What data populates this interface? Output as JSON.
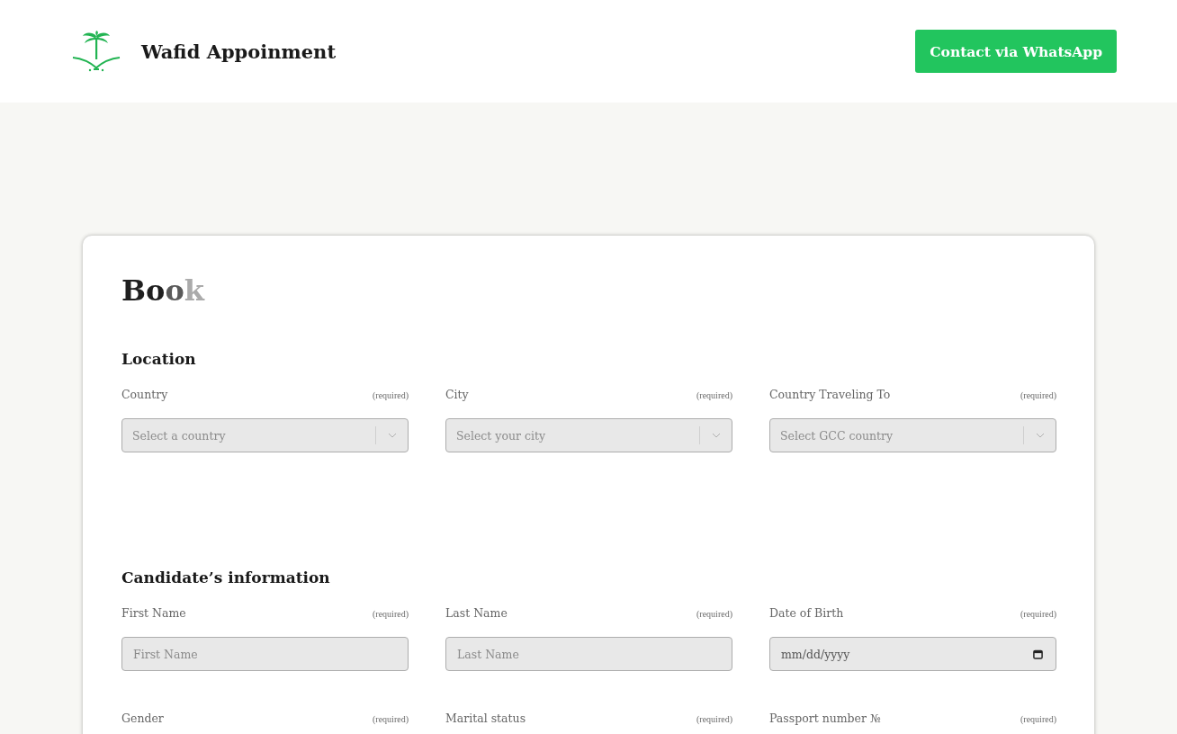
{
  "header": {
    "brand": "Wafid Appoinment",
    "contact_button": "Contact via WhatsApp"
  },
  "form": {
    "title": [
      {
        "text": "Bo",
        "color": "#1f1f1f"
      },
      {
        "text": "o",
        "color": "#5a5a5a"
      },
      {
        "text": "k",
        "color": "#ababab"
      }
    ],
    "sections": [
      {
        "heading": "Location",
        "fields": [
          {
            "label": "Country",
            "note": "(required)",
            "kind": "select",
            "placeholder": "Select a country"
          },
          {
            "label": "City",
            "note": "(required)",
            "kind": "select",
            "placeholder": "Select your city"
          },
          {
            "label": "Country Traveling To",
            "note": "(required)",
            "kind": "select",
            "placeholder": "Select GCC country"
          }
        ]
      },
      {
        "heading": "Candidate’s information",
        "fields": [
          {
            "label": "First Name",
            "note": "(required)",
            "kind": "text",
            "placeholder": "First Name"
          },
          {
            "label": "Last Name",
            "note": "(required)",
            "kind": "text",
            "placeholder": "Last Name"
          },
          {
            "label": "Date of Birth",
            "note": "(required)",
            "kind": "date",
            "placeholder": "mm/dd/yyyy"
          },
          {
            "label": "Gender",
            "note": "(required)"
          },
          {
            "label": "Marital status",
            "note": "(required)"
          },
          {
            "label": "Passport number №",
            "note": "(required)"
          }
        ]
      }
    ]
  }
}
